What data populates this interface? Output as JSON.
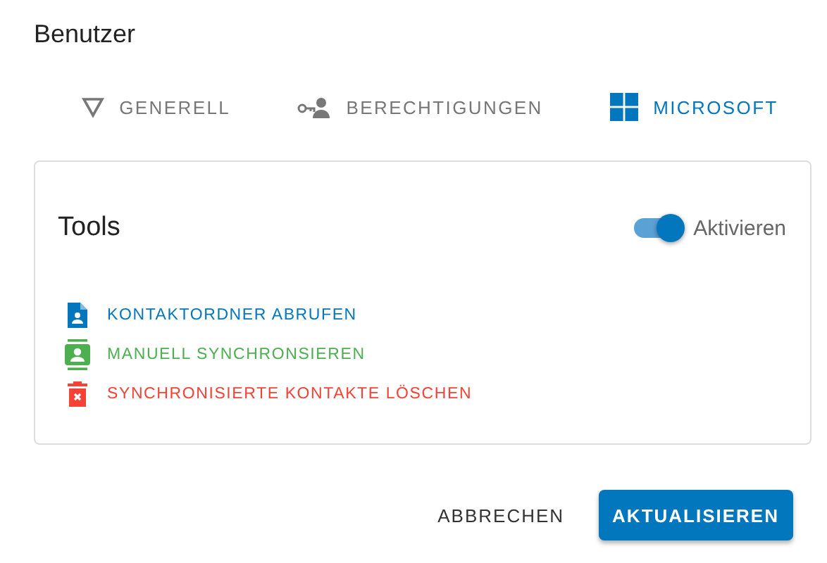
{
  "title": "Benutzer",
  "tabs": [
    {
      "label": "GENERELL",
      "kind": "filter",
      "selected": false
    },
    {
      "label": "BERECHTIGUNGEN",
      "kind": "key-person",
      "selected": false
    },
    {
      "label": "MICROSOFT",
      "kind": "windows",
      "selected": true
    }
  ],
  "card": {
    "title": "Tools",
    "toggle": {
      "label": "Aktivieren",
      "on": true
    },
    "actions": [
      {
        "label": "KONTAKTORDNER ABRUFEN",
        "kind": "document",
        "color": "#0277bd"
      },
      {
        "label": "MANUELL SYNCHRONSIEREN",
        "kind": "contacts",
        "color": "#4caf50"
      },
      {
        "label": "SYNCHRONISIERTE KONTAKTE LÖSCHEN",
        "kind": "delete",
        "color": "#f44336"
      }
    ]
  },
  "buttons": [
    {
      "label": "ABBRECHEN",
      "kind": "text"
    },
    {
      "label": "AKTUALISIEREN",
      "kind": "primary"
    }
  ]
}
